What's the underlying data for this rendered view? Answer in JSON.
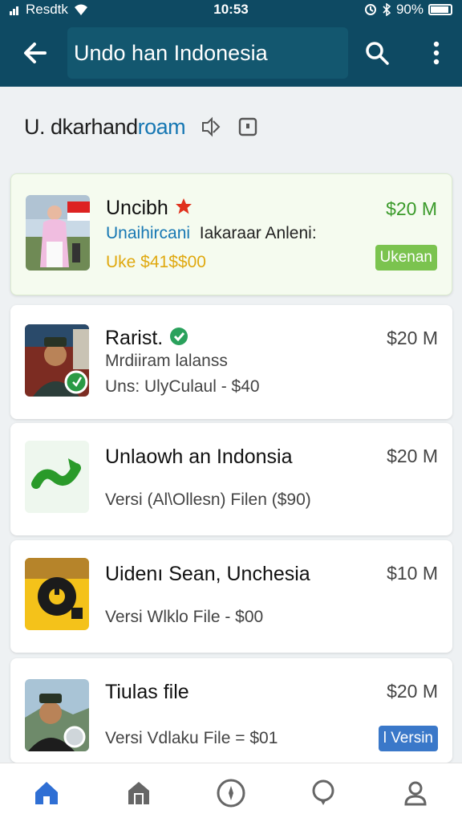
{
  "status_bar": {
    "carrier": "Resdtk",
    "time": "10:53",
    "battery": "90%",
    "battery_level": 0.9
  },
  "app_bar": {
    "title": "Undo han Indonesia"
  },
  "subheader": {
    "title_main": "U. dkarhand",
    "title_accent": "roam"
  },
  "items": [
    {
      "title": "Uncibh",
      "line1a": "Unaihircani",
      "line1b": "Iakaraar Anleni:",
      "line2": "Uke $41$$00",
      "price": "$20 M",
      "badge": "Ukenan",
      "badge_color": "#7bc34f",
      "title_color": "#111111",
      "price_color": "#3a9a2a"
    },
    {
      "title": "Rarist.",
      "line1": "Mrdiiram lalanss",
      "line2": "Uns: UlyCulaul - $40",
      "price": "$20 M"
    },
    {
      "title": "Unlaowh an Indonsia",
      "line2": "Versi  (Al\\Ollesn) Filen ($90)",
      "price": "$20 M"
    },
    {
      "title": "Uidenı Sean, Unchesia",
      "line2": "Versi  Wlklo File - $00",
      "price": "$10 M"
    },
    {
      "title": "Tiulas file",
      "line2": "Versi  Vdlaku File = $01",
      "price": "$20 M",
      "badge": "l Versin",
      "badge_color": "#3a78c9"
    }
  ],
  "colors": {
    "primary": "#0e4a63",
    "green": "#7bc34f",
    "blue": "#3a78c9",
    "gold": "#e0a910",
    "link": "#1677b3"
  },
  "nav": [
    "home-icon",
    "store-icon",
    "compass-icon",
    "chat-icon",
    "profile-icon"
  ]
}
